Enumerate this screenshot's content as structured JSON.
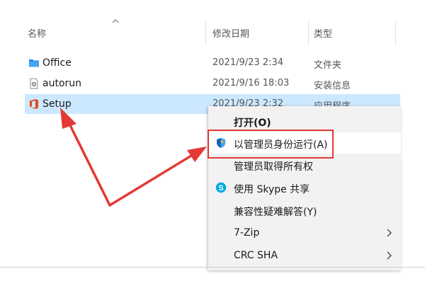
{
  "columns": {
    "name": "名称",
    "modified": "修改日期",
    "type": "类型"
  },
  "files": [
    {
      "name": "Office",
      "date": "2021/9/23 2:34",
      "type": "文件夹",
      "icon": "folder-icon",
      "selected": false
    },
    {
      "name": "autorun",
      "date": "2021/9/16 18:03",
      "type": "安装信息",
      "icon": "setup-info-file-icon",
      "selected": false
    },
    {
      "name": "Setup",
      "date": "2021/9/23 2:32",
      "type": "应用程序",
      "icon": "office-logo-icon",
      "selected": true
    }
  ],
  "context_menu": {
    "items": [
      {
        "label": "打开(O)",
        "bold": true
      },
      {
        "label": "以管理员身份运行(A)",
        "icon": "uac-shield-icon",
        "highlighted": true
      },
      {
        "label": "管理员取得所有权"
      },
      {
        "label": "使用 Skype 共享",
        "icon": "skype-icon"
      },
      {
        "label": "兼容性疑难解答(Y)"
      },
      {
        "label": "7-Zip",
        "submenu": true
      },
      {
        "label": "CRC SHA",
        "submenu": true
      }
    ]
  },
  "colors": {
    "selection": "#cce8ff",
    "menu_bg": "#f2f2f2",
    "annotation_red": "#e53935",
    "folder": "#1e88e5",
    "office_red": "#e64a19",
    "shield_blue": "#1565c0",
    "skype_blue": "#00a9e0"
  }
}
